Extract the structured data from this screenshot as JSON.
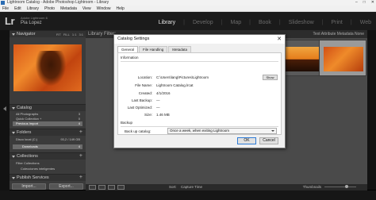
{
  "window": {
    "title": "Lightroom Catalog - Adobe Photoshop Lightroom - Library",
    "controls": [
      "–",
      "□",
      "✕"
    ]
  },
  "menu": [
    "File",
    "Edit",
    "Library",
    "Photo",
    "Metadata",
    "View",
    "Window",
    "Help"
  ],
  "identity": {
    "logo": "Lr",
    "product": "Adobe Lightroom 6",
    "user": "Pia Lopez",
    "modules": [
      "Library",
      "Develop",
      "Map",
      "Book",
      "Slideshow",
      "Print",
      "Web"
    ],
    "separator": "|",
    "active_module": "Library"
  },
  "left_panel": {
    "navigator": {
      "label": "Navigator",
      "tabs": [
        "FIT",
        "FILL",
        "1:1",
        "3:1"
      ]
    },
    "catalog": {
      "label": "Catalog",
      "items": [
        {
          "label": "All Photographs",
          "count": "3"
        },
        {
          "label": "Quick Collection +",
          "count": "0"
        },
        {
          "label": "Previous Import",
          "count": "4"
        }
      ]
    },
    "folders": {
      "label": "Folders",
      "volume": {
        "label": "Disco local (C:)",
        "info": "93,2 / 149 GB"
      },
      "items": [
        {
          "label": "Downloads",
          "count": "4"
        }
      ]
    },
    "collections": {
      "label": "Collections",
      "items": [
        {
          "label": "Filter Collections"
        },
        {
          "label": "Colecciones inteligentes"
        }
      ]
    },
    "publish": {
      "label": "Publish Services"
    },
    "buttons": {
      "import": "Import...",
      "export": "Export..."
    }
  },
  "grid": {
    "header": "Library Filter:",
    "filters": "Text   Attribute   Metadata   None"
  },
  "toolbar": {
    "sort_label": "Sort:",
    "sort_value": "Capture Time",
    "thumbnails_label": "Thumbnails"
  },
  "dialog": {
    "title": "Catalog Settings",
    "close": "✕",
    "tabs": [
      "General",
      "File Handling",
      "Metadata"
    ],
    "active_tab": "General",
    "information": {
      "heading": "Information",
      "rows": [
        {
          "label": "Location:",
          "value": "C:\\Users\\lang\\Pictures\\Lightroom"
        },
        {
          "label": "File Name:",
          "value": "Lightroom Catalog.lrcat"
        },
        {
          "label": "Created:",
          "value": "4/1/2016"
        },
        {
          "label": "Last Backup:",
          "value": "—"
        },
        {
          "label": "Last Optimized:",
          "value": "—"
        },
        {
          "label": "Size:",
          "value": "1.46 MB"
        }
      ],
      "show_button": "Show"
    },
    "backup": {
      "heading": "Backup",
      "label": "Back up catalog:",
      "selected": "Once a week, when exiting Lightroom"
    },
    "buttons": {
      "ok": "OK",
      "cancel": "Cancel"
    }
  }
}
